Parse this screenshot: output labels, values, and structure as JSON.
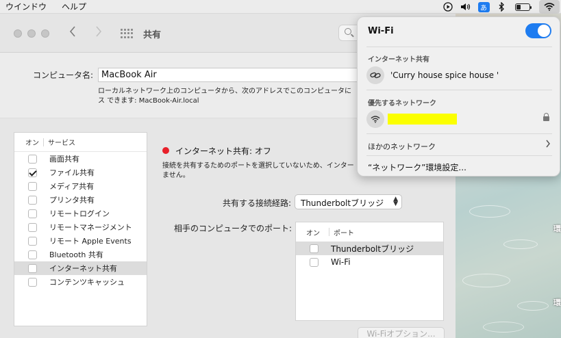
{
  "menubar": {
    "menus": [
      "ウインドウ",
      "ヘルプ"
    ],
    "ime_label": "あ",
    "battery_level": 0.35,
    "icons": [
      "play-circle-icon",
      "speaker-volume-icon",
      "input-method-icon",
      "bluetooth-icon",
      "battery-icon",
      "wifi-icon"
    ]
  },
  "window": {
    "title": "共有",
    "computer_name_label": "コンピュータ名:",
    "computer_name_value": "MacBook Air",
    "computer_name_desc": "ローカルネットワーク上のコンピュータから、次のアドレスでこのコンピュータに ス できます: MacBook-Air.local",
    "services": {
      "header_on": "オン",
      "header_service": "サービス",
      "items": [
        {
          "label": "画面共有",
          "checked": false,
          "selected": false
        },
        {
          "label": "ファイル共有",
          "checked": true,
          "selected": false
        },
        {
          "label": "メディア共有",
          "checked": false,
          "selected": false
        },
        {
          "label": "プリンタ共有",
          "checked": false,
          "selected": false
        },
        {
          "label": "リモートログイン",
          "checked": false,
          "selected": false
        },
        {
          "label": "リモートマネージメント",
          "checked": false,
          "selected": false
        },
        {
          "label": "リモート Apple Events",
          "checked": false,
          "selected": false
        },
        {
          "label": "Bluetooth 共有",
          "checked": false,
          "selected": false
        },
        {
          "label": "インターネット共有",
          "checked": false,
          "selected": true
        },
        {
          "label": "コンテンツキャッシュ",
          "checked": false,
          "selected": false
        }
      ]
    },
    "status": {
      "text": "インターネット共有: オフ",
      "color": "#e8202a",
      "desc": "接続を共有するためのポートを選択していないため、インター ません。"
    },
    "share_from_label": "共有する接続経路:",
    "share_from_value": "Thunderboltブリッジ",
    "ports_label": "相手のコンピュータでのポート:",
    "ports": {
      "header_on": "オン",
      "header_port": "ポート",
      "items": [
        {
          "label": "Thunderboltブリッジ",
          "checked": false,
          "selected": true
        },
        {
          "label": "Wi-Fi",
          "checked": false,
          "selected": false
        }
      ]
    },
    "wifi_options_button": "Wi-Fiオプション..."
  },
  "wifi_popover": {
    "title": "Wi-Fi",
    "enabled": true,
    "accent_color": "#1e7cf0",
    "hotspot_section": "インターネット共有",
    "hotspot_name": "'Curry house spice house '",
    "preferred_section": "優先するネットワーク",
    "other_networks": "ほかのネットワーク",
    "network_settings": "“ネットワーク”環境設定..."
  },
  "desktop": {
    "glyph": "環"
  }
}
